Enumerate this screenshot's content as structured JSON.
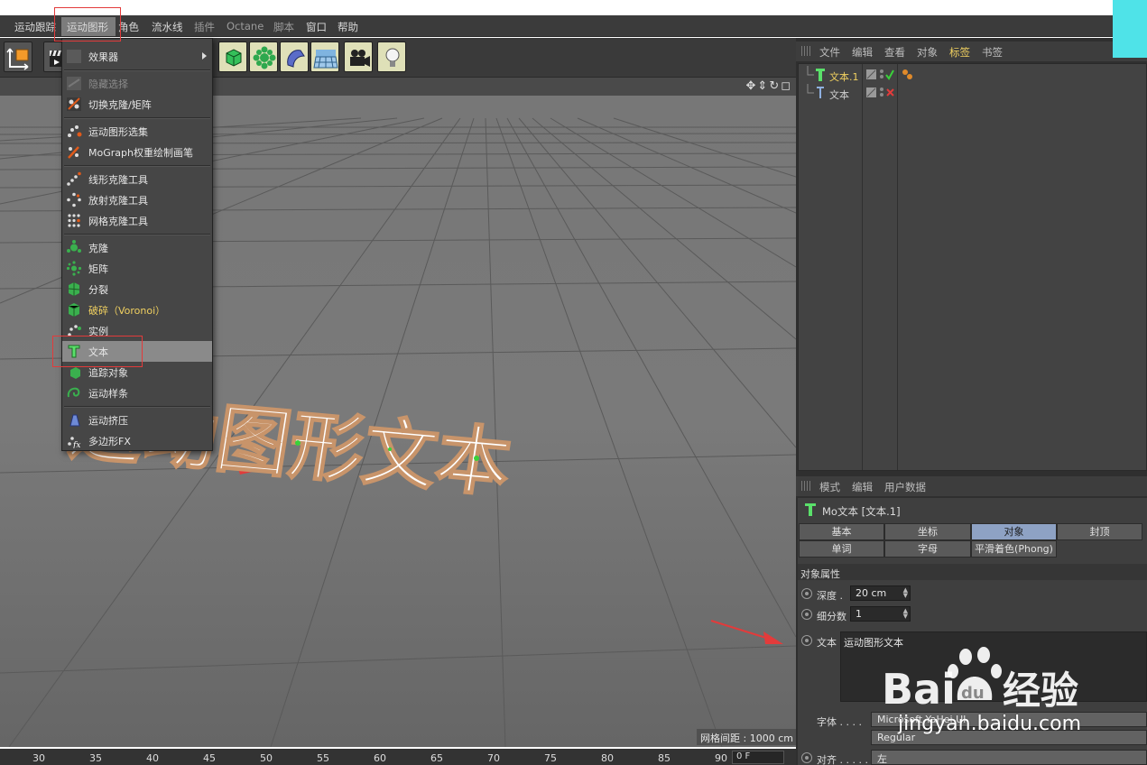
{
  "menubar": {
    "items": [
      {
        "label": "运动跟踪"
      },
      {
        "label": "运动图形"
      },
      {
        "label": "角色"
      },
      {
        "label": "流水线"
      },
      {
        "label": "插件"
      },
      {
        "label": "Octane"
      },
      {
        "label": "脚本"
      },
      {
        "label": "窗口"
      },
      {
        "label": "帮助"
      }
    ],
    "active": "运动图形"
  },
  "dropdown": {
    "items": [
      {
        "label": "效果器",
        "icon": "effector-icon",
        "has_submenu": true
      },
      {
        "label": "隐藏选择",
        "icon": "hide-selection-icon",
        "disabled": true
      },
      {
        "label": "切换克隆/矩阵",
        "icon": "toggle-clone-icon"
      },
      {
        "label": "运动图形选集",
        "icon": "mograph-selection-icon"
      },
      {
        "label": "MoGraph权重绘制画笔",
        "icon": "weight-brush-icon"
      },
      {
        "label": "线形克隆工具",
        "icon": "linear-clone-icon"
      },
      {
        "label": "放射克隆工具",
        "icon": "radial-clone-icon"
      },
      {
        "label": "网格克隆工具",
        "icon": "grid-clone-icon"
      },
      {
        "label": "克隆",
        "icon": "cloner-icon"
      },
      {
        "label": "矩阵",
        "icon": "matrix-icon"
      },
      {
        "label": "分裂",
        "icon": "fracture-icon"
      },
      {
        "label": "破碎（Voronoi）",
        "icon": "voronoi-icon"
      },
      {
        "label": "实例",
        "icon": "instance-icon"
      },
      {
        "label": "文本",
        "icon": "text-icon",
        "highlighted": true
      },
      {
        "label": "追踪对象",
        "icon": "tracer-icon"
      },
      {
        "label": "运动样条",
        "icon": "spline-icon"
      },
      {
        "label": "运动挤压",
        "icon": "extrude-icon"
      },
      {
        "label": "多边形FX",
        "icon": "polyfx-icon"
      }
    ]
  },
  "object_manager": {
    "tabs": [
      "文件",
      "编辑",
      "查看",
      "对象",
      "标签",
      "书签"
    ],
    "objects": [
      {
        "name": "文本.1",
        "selected": true
      },
      {
        "name": "文本",
        "selected": false
      }
    ]
  },
  "attributes": {
    "tabs": [
      "模式",
      "编辑",
      "用户数据"
    ],
    "title": "Mo文本 [文本.1]",
    "tab_row1": [
      "基本",
      "坐标",
      "对象",
      "封顶"
    ],
    "tab_row2": [
      "单词",
      "字母",
      "平滑着色(Phong)"
    ],
    "active_tab": "对象",
    "section": "对象属性",
    "depth_label": "深度 .",
    "depth_value": "20 cm",
    "subdiv_label": "细分数",
    "subdiv_value": "1",
    "text_label": "文本",
    "text_value": "运动图形文本",
    "font_label": "字体 . . . .",
    "font_value": "Microsoft YaHei UI",
    "font_style": "Regular",
    "align_label": "对齐 . . . . .",
    "align_value": "左"
  },
  "viewport": {
    "scene_text": "运动图形文本",
    "grid_readout": "网格间距 : 1000 cm"
  },
  "timeline": {
    "ticks": [
      "30",
      "35",
      "40",
      "45",
      "50",
      "55",
      "60",
      "65",
      "70",
      "75",
      "80",
      "85",
      "90"
    ],
    "frame": "0 F"
  },
  "watermark": {
    "brand": "Bai du 经验",
    "url": "jingyan.baidu.com"
  },
  "colors": {
    "accent_yellow": "#f0d060",
    "highlight_red": "#e23b3b",
    "tab_active": "#8ea2c4",
    "cyan_block": "#4fe3e8"
  }
}
